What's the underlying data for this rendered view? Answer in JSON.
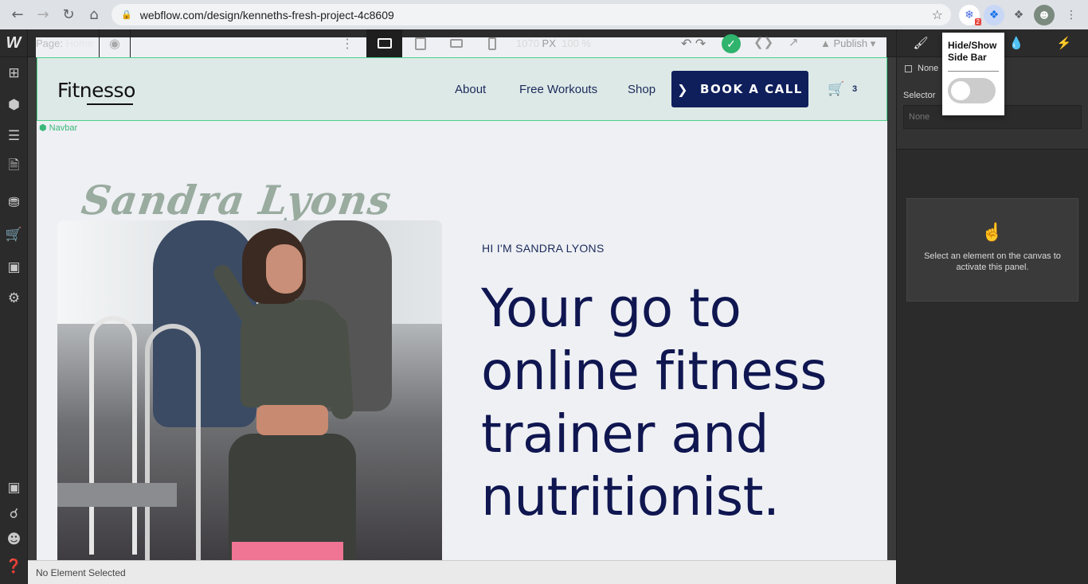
{
  "browser": {
    "url": "webflow.com/design/kenneths-fresh-project-4c8609",
    "extension_badge": "2"
  },
  "topbar": {
    "page_label": "Page:",
    "page_name": "Home",
    "width_value": "1070",
    "width_unit": "PX",
    "zoom": "100 %",
    "publish_label": "Publish"
  },
  "popup": {
    "title": "Hide/Show Side Bar",
    "toggle_on": false
  },
  "right_panel": {
    "none_label": "None",
    "selector_label": "Selector",
    "selector_placeholder": "None",
    "empty_message": "Select an element on the canvas to activate this panel."
  },
  "site": {
    "brand": "Fitnesso",
    "nav": [
      "About",
      "Free Workouts",
      "Shop"
    ],
    "cta": "BOOK A CALL",
    "cart_count": "3",
    "navbar_tag": "Navbar",
    "script_name": "Sandra Lyons",
    "eyebrow": "HI I'M SANDRA LYONS",
    "headline": "Your go to online fitness trainer and nutritionist."
  },
  "status": "No Element Selected",
  "colors": {
    "accent": "#0f1f5c",
    "selection": "#4bd08b",
    "publish_check": "#2fb36d"
  }
}
